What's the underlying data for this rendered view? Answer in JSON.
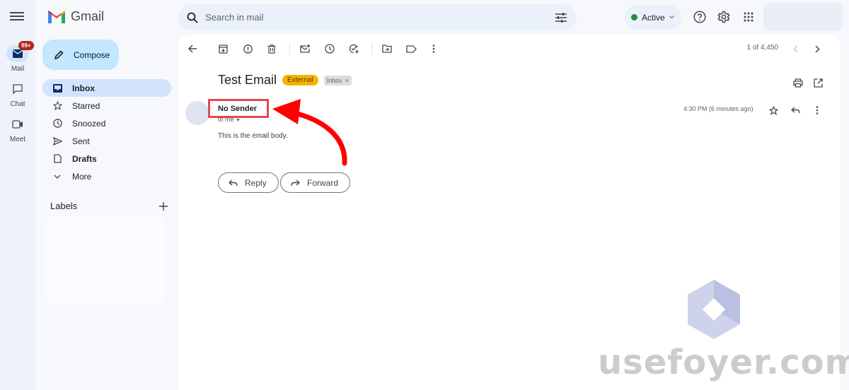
{
  "app": {
    "name": "Gmail"
  },
  "rail": {
    "items": [
      {
        "label": "Mail",
        "icon": "mail-icon",
        "badge": "99+",
        "active": true
      },
      {
        "label": "Chat",
        "icon": "chat-icon"
      },
      {
        "label": "Meet",
        "icon": "video-icon"
      }
    ]
  },
  "sidebar": {
    "compose_label": "Compose",
    "items": [
      {
        "label": "Inbox",
        "icon": "inbox-icon",
        "active": true
      },
      {
        "label": "Starred",
        "icon": "star-icon"
      },
      {
        "label": "Snoozed",
        "icon": "clock-icon"
      },
      {
        "label": "Sent",
        "icon": "send-icon"
      },
      {
        "label": "Drafts",
        "icon": "draft-icon",
        "bold": true
      },
      {
        "label": "More",
        "icon": "chevron-down-icon"
      }
    ],
    "labels_heading": "Labels"
  },
  "search": {
    "placeholder": "Search in mail"
  },
  "status": {
    "label": "Active",
    "color": "#1e8e3e"
  },
  "toolbar": {
    "pager_text": "1 of 4,450"
  },
  "email": {
    "subject": "Test Email",
    "tags": {
      "external": "External",
      "inbox": "Inbox",
      "inbox_remove": "×"
    },
    "sender": "No Sender",
    "recipient": "to me",
    "time": "4:30 PM (6 minutes ago)",
    "body": "This is the email body.",
    "reply_label": "Reply",
    "forward_label": "Forward"
  },
  "annotation": {
    "color": "#e8474c",
    "arrow_color": "#ff0000"
  },
  "watermark": {
    "text": "usefoyer.com"
  }
}
